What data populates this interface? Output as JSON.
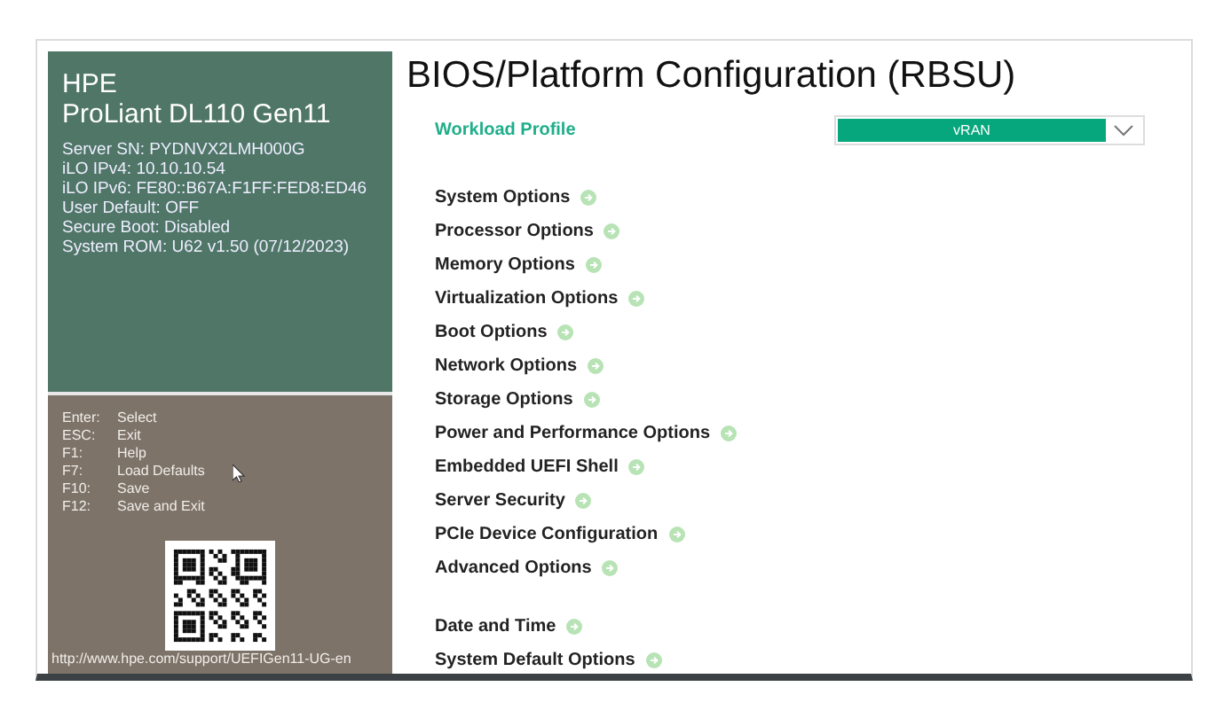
{
  "system": {
    "vendor": "HPE",
    "model": "ProLiant DL110 Gen11",
    "details": [
      "Server SN: PYDNVX2LMH000G",
      "iLO IPv4: 10.10.10.54",
      "iLO IPv6: FE80::B67A:F1FF:FED8:ED46",
      "User Default: OFF",
      "Secure Boot: Disabled",
      "System ROM: U62 v1.50 (07/12/2023)"
    ]
  },
  "keys": [
    {
      "key": "Enter:",
      "action": "Select"
    },
    {
      "key": "ESC:",
      "action": "Exit"
    },
    {
      "key": "F1:",
      "action": "Help"
    },
    {
      "key": "F7:",
      "action": "Load Defaults"
    },
    {
      "key": "F10:",
      "action": "Save"
    },
    {
      "key": "F12:",
      "action": "Save and Exit"
    }
  ],
  "help_url": "http://www.hpe.com/support/UEFIGen11-UG-en",
  "title": "BIOS/Platform Configuration (RBSU)",
  "workload_profile": {
    "label": "Workload Profile",
    "selected": true,
    "value": "vRAN"
  },
  "menu_groups": [
    [
      {
        "label": "System Options",
        "selected": false
      },
      {
        "label": "Processor Options",
        "selected": false
      },
      {
        "label": "Memory Options",
        "selected": false
      },
      {
        "label": "Virtualization Options",
        "selected": false
      },
      {
        "label": "Boot Options",
        "selected": false
      },
      {
        "label": "Network Options",
        "selected": false
      },
      {
        "label": "Storage Options",
        "selected": false
      },
      {
        "label": "Power and Performance Options",
        "selected": false
      },
      {
        "label": "Embedded UEFI Shell",
        "selected": false
      },
      {
        "label": "Server Security",
        "selected": false
      },
      {
        "label": "PCIe Device Configuration",
        "selected": false
      },
      {
        "label": "Advanced Options",
        "selected": false
      }
    ],
    [
      {
        "label": "Date and Time",
        "selected": false
      },
      {
        "label": "System Default Options",
        "selected": false
      }
    ]
  ]
}
